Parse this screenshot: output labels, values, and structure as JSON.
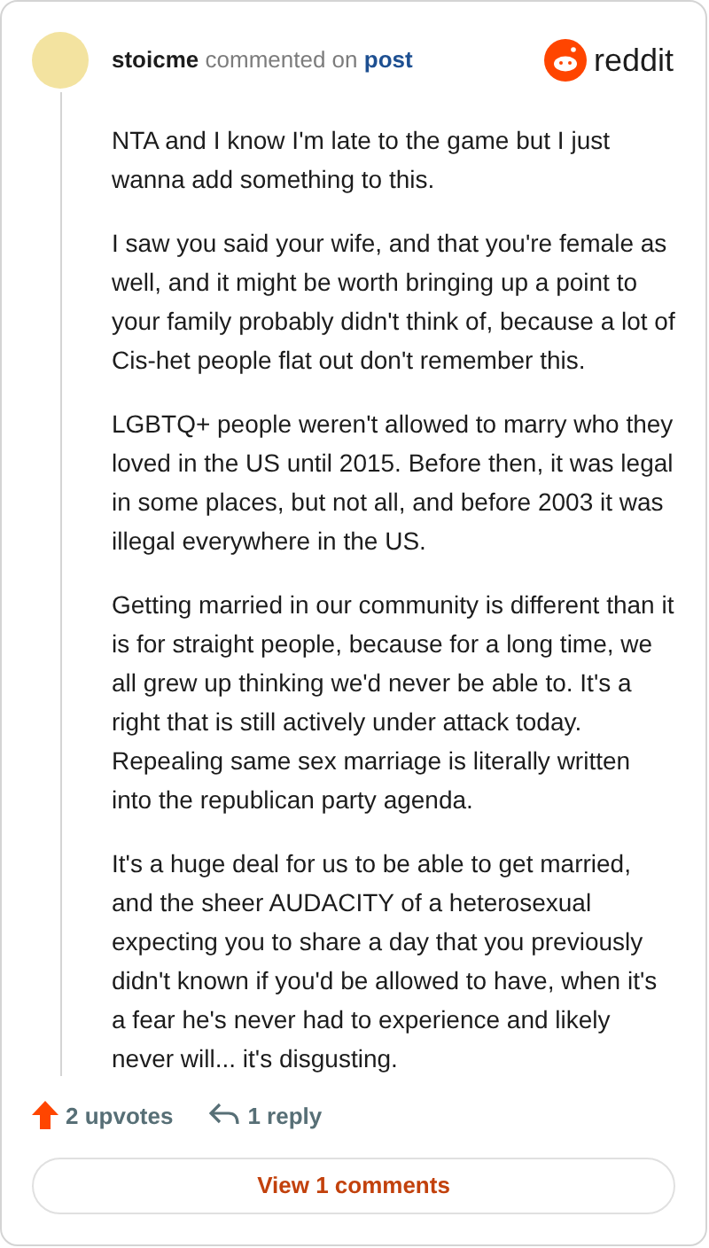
{
  "comment": {
    "author": "stoicme",
    "action": "commented on",
    "link": "post"
  },
  "brand": {
    "name": "reddit"
  },
  "paragraphs": [
    "NTA and I know I'm late to the game but I just wanna add something to this.",
    "I saw you said your wife, and that you're female as well, and it might be worth bringing up a point to your family probably didn't think of, because a lot of Cis-het people flat out don't remember this.",
    "LGBTQ+ people weren't allowed to marry who they loved in the US until 2015. Before then, it was legal in some places, but not all, and before 2003 it was illegal everywhere in the US.",
    "Getting married in our community is different than it is for straight people, because for a long time, we all grew up thinking we'd never be able to. It's a right that is still actively under attack today. Repealing same sex marriage is literally written into the republican party agenda.",
    "It's a huge deal for us to be able to get married, and the sheer AUDACITY of a heterosexual expecting you to share a day that you previously didn't known if you'd be allowed to have, when it's a fear he's never had to experience and likely never will... it's disgusting."
  ],
  "footer": {
    "upvotes": "2 upvotes",
    "replies": "1 reply",
    "view_button": "View 1 comments"
  }
}
